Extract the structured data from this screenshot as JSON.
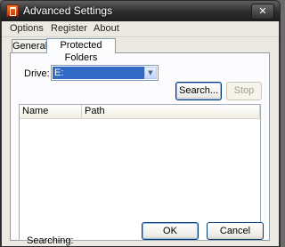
{
  "window": {
    "title": "Advanced Settings",
    "close_label": "✕"
  },
  "menu": [
    "Options",
    "Register",
    "About"
  ],
  "tabs": [
    {
      "label": "General",
      "active": false
    },
    {
      "label": "Protected Folders",
      "active": true
    }
  ],
  "drive": {
    "label": "Drive:",
    "value": "E:"
  },
  "buttons": {
    "search": "Search...",
    "stop": "Stop",
    "ok": "OK",
    "cancel": "Cancel"
  },
  "list": {
    "columns": [
      "Name",
      "Path"
    ],
    "rows": []
  },
  "status": "Searching:",
  "colors": {
    "selection": "#316ac5",
    "dialog_bg": "#ece9e2"
  }
}
